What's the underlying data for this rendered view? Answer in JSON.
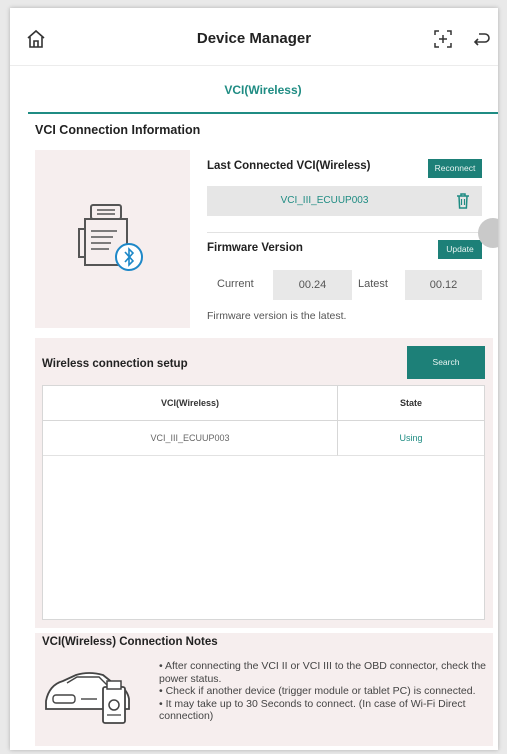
{
  "header": {
    "title": "Device Manager"
  },
  "tabs": [
    {
      "label": "VCI(Wireless)",
      "active": true
    }
  ],
  "connection_info": {
    "section_title": "VCI Connection Information",
    "last_connected_label": "Last Connected VCI(Wireless)",
    "reconnect_label": "Reconnect",
    "vci_name": "VCI_III_ECUUP003",
    "firmware_label": "Firmware Version",
    "update_label": "Update",
    "current_label": "Current",
    "current_value": "00.24",
    "latest_label": "Latest",
    "latest_value": "00.12",
    "firmware_note": "Firmware version is the latest."
  },
  "wireless_setup": {
    "section_title": "Wireless connection setup",
    "search_label": "Search",
    "columns": [
      "VCI(Wireless)",
      "State"
    ],
    "rows": [
      {
        "vci": "VCI_III_ECUUP003",
        "state": "Using"
      }
    ]
  },
  "notes": {
    "title": "VCI(Wireless) Connection Notes",
    "items": [
      "• After connecting the VCI II or VCI III to the OBD connector, check the power status.",
      "• Check if another device (trigger module or tablet PC) is connected.",
      "• It may take up to 30 Seconds to connect. (In case of Wi-Fi Direct connection)"
    ]
  },
  "colors": {
    "accent": "#1f8c83",
    "button": "#1d8078",
    "panel_bg": "#f6eeee"
  }
}
